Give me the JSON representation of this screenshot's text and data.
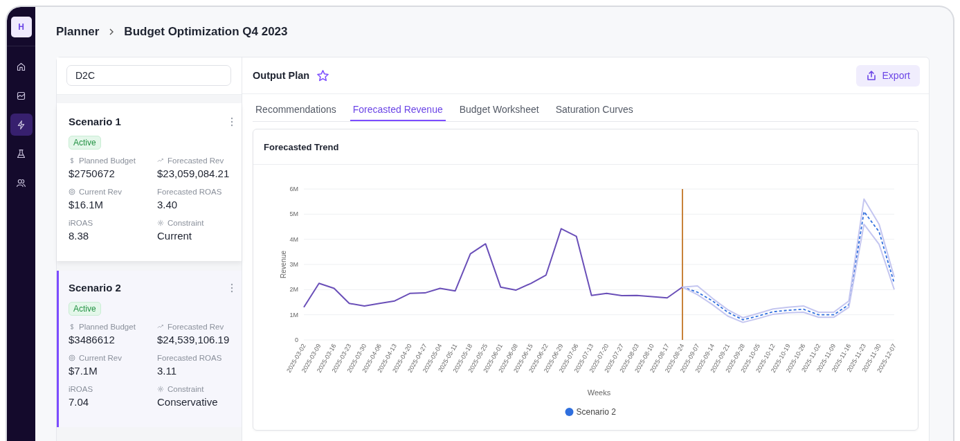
{
  "logo": "H",
  "nav": [
    {
      "kind": "home",
      "selected": false
    },
    {
      "kind": "chart",
      "selected": false
    },
    {
      "kind": "bolt",
      "selected": true
    },
    {
      "kind": "flask",
      "selected": false
    },
    {
      "kind": "users",
      "selected": false
    }
  ],
  "breadcrumb": [
    "Planner",
    "Budget Optimization Q4 2023"
  ],
  "search": {
    "value": "D2C"
  },
  "scenarios": [
    {
      "title": "Scenario 1",
      "status": "Active",
      "selected": false,
      "metrics": [
        {
          "kind": "dollar",
          "label": "Planned Budget",
          "value": "$2750672"
        },
        {
          "kind": "trend",
          "label": "Forecasted Rev",
          "value": "$23,059,084.21"
        },
        {
          "kind": "target",
          "label": "Current Rev",
          "value": "$16.1M"
        },
        {
          "kind": "plain",
          "label": "Forecasted ROAS",
          "value": "3.40"
        },
        {
          "kind": "plain",
          "label": "iROAS",
          "value": "8.38"
        },
        {
          "kind": "gear",
          "label": "Constraint",
          "value": "Current"
        }
      ]
    },
    {
      "title": "Scenario 2",
      "status": "Active",
      "selected": true,
      "metrics": [
        {
          "kind": "dollar",
          "label": "Planned Budget",
          "value": "$3486612"
        },
        {
          "kind": "trend",
          "label": "Forecasted Rev",
          "value": "$24,539,106.19"
        },
        {
          "kind": "target",
          "label": "Current Rev",
          "value": "$7.1M"
        },
        {
          "kind": "plain",
          "label": "Forecasted ROAS",
          "value": "3.11"
        },
        {
          "kind": "plain",
          "label": "iROAS",
          "value": "7.04"
        },
        {
          "kind": "gear",
          "label": "Constraint",
          "value": "Conservative"
        }
      ]
    }
  ],
  "output": {
    "title": "Output Plan",
    "starred": false,
    "export_label": "Export"
  },
  "tabs": [
    {
      "label": "Recommendations",
      "selected": false
    },
    {
      "label": "Forecasted Revenue",
      "selected": true
    },
    {
      "label": "Budget Worksheet",
      "selected": false
    },
    {
      "label": "Saturation Curves",
      "selected": false
    }
  ],
  "chart_card": {
    "title": "Forecasted Trend",
    "chart_data": {
      "type": "line",
      "xlabel": "Weeks",
      "ylabel": "Revenue",
      "grid": true,
      "categories": [
        "2025-03-02",
        "2025-03-09",
        "2025-03-16",
        "2025-03-23",
        "2025-03-30",
        "2025-04-06",
        "2025-04-13",
        "2025-04-20",
        "2025-04-27",
        "2025-05-04",
        "2025-05-11",
        "2025-05-18",
        "2025-05-25",
        "2025-06-01",
        "2025-06-08",
        "2025-06-15",
        "2025-06-22",
        "2025-06-29",
        "2025-07-06",
        "2025-07-13",
        "2025-07-20",
        "2025-07-27",
        "2025-08-03",
        "2025-08-10",
        "2025-08-17",
        "2025-08-24",
        "2025-09-07",
        "2025-09-14",
        "2025-09-21",
        "2025-09-28",
        "2025-10-05",
        "2025-10-12",
        "2025-10-19",
        "2025-10-26",
        "2025-11-02",
        "2025-11-09",
        "2025-11-16",
        "2025-11-23",
        "2025-11-30",
        "2025-12-07"
      ],
      "ylim": [
        0,
        6000000
      ],
      "yticks": [
        {
          "value": 0,
          "label": "0"
        },
        {
          "value": 1000000,
          "label": "1M"
        },
        {
          "value": 2000000,
          "label": "2M"
        },
        {
          "value": 3000000,
          "label": "3M"
        },
        {
          "value": 4000000,
          "label": "4M"
        },
        {
          "value": 5000000,
          "label": "5M"
        },
        {
          "value": 6000000,
          "label": "6M"
        }
      ],
      "series": [
        {
          "color": "#6a4fb8",
          "line_style": "solid",
          "values": [
            1300000,
            2250000,
            2050000,
            1450000,
            1350000,
            1450000,
            1550000,
            1850000,
            1870000,
            2050000,
            1950000,
            3420000,
            3820000,
            2100000,
            1980000,
            2250000,
            2580000,
            4420000,
            4120000,
            1770000,
            1850000,
            1760000,
            1770000,
            1720000,
            1670000,
            2100000,
            null,
            null,
            null,
            null,
            null,
            null,
            null,
            null,
            null,
            null,
            null,
            null,
            null,
            null
          ]
        },
        {
          "name": "Scenario 2",
          "color": "#2f6fde",
          "line_style": "dashed",
          "values": [
            null,
            null,
            null,
            null,
            null,
            null,
            null,
            null,
            null,
            null,
            null,
            null,
            null,
            null,
            null,
            null,
            null,
            null,
            null,
            null,
            null,
            null,
            null,
            null,
            null,
            2100000,
            1900000,
            1550000,
            1100000,
            800000,
            950000,
            1120000,
            1180000,
            1220000,
            1000000,
            1000000,
            1400000,
            5100000,
            4300000,
            2250000
          ]
        },
        {
          "color": "#c4c6f0",
          "line_style": "solid",
          "values": [
            null,
            null,
            null,
            null,
            null,
            null,
            null,
            null,
            null,
            null,
            null,
            null,
            null,
            null,
            null,
            null,
            null,
            null,
            null,
            null,
            null,
            null,
            null,
            null,
            null,
            2100000,
            2150000,
            1650000,
            1200000,
            880000,
            1050000,
            1230000,
            1300000,
            1350000,
            1100000,
            1100000,
            1550000,
            5600000,
            4600000,
            2500000
          ]
        },
        {
          "color": "#c4c6f0",
          "line_style": "solid",
          "values": [
            null,
            null,
            null,
            null,
            null,
            null,
            null,
            null,
            null,
            null,
            null,
            null,
            null,
            null,
            null,
            null,
            null,
            null,
            null,
            null,
            null,
            null,
            null,
            null,
            null,
            2100000,
            1800000,
            1400000,
            950000,
            700000,
            850000,
            1020000,
            1080000,
            1100000,
            900000,
            900000,
            1300000,
            4600000,
            3800000,
            2000000
          ]
        }
      ],
      "ref_lines": [
        {
          "axis": "x",
          "value": "2025-08-24",
          "color": "#c8823a"
        }
      ]
    }
  }
}
